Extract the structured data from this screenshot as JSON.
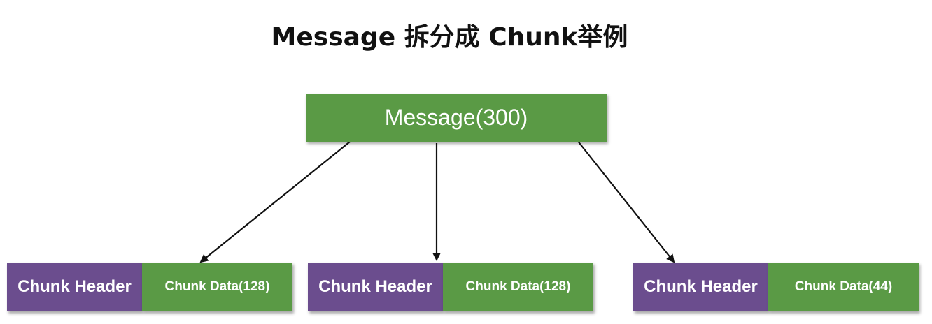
{
  "title": "Message 拆分成 Chunk举例",
  "message": {
    "label": "Message(300)",
    "color": "#5a9a45"
  },
  "chunks": [
    {
      "header": "Chunk Header",
      "data": "Chunk Data(128)"
    },
    {
      "header": "Chunk Header",
      "data": "Chunk Data(128)"
    },
    {
      "header": "Chunk Header",
      "data": "Chunk Data(44)"
    }
  ],
  "colors": {
    "header": "#6b4d8e",
    "data": "#5a9a45",
    "arrow": "#111111"
  }
}
